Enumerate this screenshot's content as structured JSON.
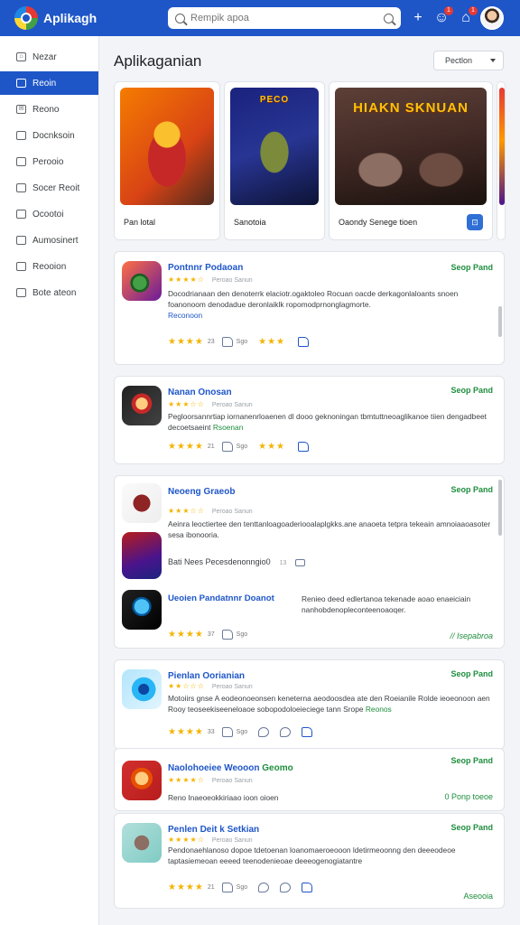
{
  "topbar": {
    "app_name": "Aplikagh",
    "search_placeholder": "Rempik apoa",
    "add_icon": "plus-icon",
    "notif1_count": "1",
    "notif2_count": "1"
  },
  "sidebar": {
    "items": [
      {
        "label": "Nezar",
        "icon": "home-icon"
      },
      {
        "label": "Reoin",
        "icon": "apps-icon"
      },
      {
        "label": "Reono",
        "icon": "mail-icon"
      },
      {
        "label": "Docnksoin",
        "icon": "doc-icon"
      },
      {
        "label": "Perooio",
        "icon": "folder-icon"
      },
      {
        "label": "Socer Reoit",
        "icon": "chart-icon"
      },
      {
        "label": "Ocootoi",
        "icon": "box-icon"
      },
      {
        "label": "Aumosinert",
        "icon": "settings-icon"
      },
      {
        "label": "Reooion",
        "icon": "list-icon"
      },
      {
        "label": "Bote ateon",
        "icon": "share-icon"
      }
    ],
    "active_index": 1
  },
  "main": {
    "title": "Aplikaganian",
    "sort_label": "Pectlon"
  },
  "featured": [
    {
      "caption": "Pan lotal",
      "art_text": ""
    },
    {
      "caption": "Sanotoia",
      "art_text": "PECO"
    },
    {
      "caption": "Oaondy Senege tioen",
      "art_text": "HIAKN SKNUAN"
    }
  ],
  "apps": [
    {
      "name": "Pontnnr Podaoan",
      "rating": "★★★★☆",
      "rating_sub": "Peroao Sanun",
      "desc": "Docodrianaan den denoterrk elaciotr.ogaktoleo Rocuan oacde derkagonlaloants snoen foanonoom denodadue deronlaiklk ropomodprnonglagmorte.",
      "desc_link": "Reconoon",
      "metric_stars": "★★★★",
      "metric_num": "23",
      "metric_txt": "Sgo",
      "metric_stars2": "★★★",
      "get_label": "Seop Pand"
    },
    {
      "name": "Nanan Onosan",
      "rating": "★★★☆☆",
      "rating_sub": "Peroao Sanun",
      "desc": "Pegloorsannrtiap iornanenrloaenen dl dooo geknoningan tbmtuttneoaglikanoe tiien dengadbeet decoetsaeint",
      "desc_link": "Rsoenan",
      "metric_stars": "★★★★",
      "metric_num": "21",
      "metric_txt": "Sgo",
      "metric_stars2": "★★★",
      "get_label": "Seop Pand"
    },
    {
      "name": "Neoeng Graeob",
      "rating": "★★★☆☆",
      "rating_sub": "Peroao Sanun",
      "desc": "Aeinra leoctiertee  den tenttanloagoaderiooalaplgkks.ane anaoeta tetpra tekeain amnoiaaoasoter sesa ibonooria.",
      "sub_label": "Bati Nees Pecesdenonngio0",
      "sub_mini": "13",
      "get_label": "Seop Pand"
    },
    {
      "name": "Ueoien Pandatnnr Doanot",
      "desc": "Renieo deed edlertanoa tekenade aoao enaeiciain nanhobdenopleconteenoaoqer.",
      "metric_stars": "★★★★",
      "metric_num": "37",
      "metric_txt": "Sgo",
      "more_label": "// Isepabroa"
    },
    {
      "name": "Pienlan Oorianian",
      "rating": "★★☆☆☆",
      "rating_sub": "Peroao Sanun",
      "desc": "Motoiirs gnse A eodeonoeonsen keneterna aeodoosdea ate den Roeianile Rolde ieoeonoon aen Rooy teoseekiseeneloaoe sobopodoloeieciege tann Srope",
      "desc_link": "Reonos",
      "metric_stars": "★★★★",
      "metric_num": "33",
      "metric_txt": "Sgo",
      "get_label": "Seop Pand"
    },
    {
      "name": "Naolohoeiee Weooon",
      "name_extra": "Geomo",
      "rating": "★★★★☆",
      "rating_sub": "Peroao Sanun",
      "desc": "Reno Inaeoeokkiriaao ioon oioen ooeonaelonatomnadioeoeeaoeloatemgnaahdeen.",
      "get_label": "Seop Pand",
      "more_label": "0 Ponp toeoe"
    },
    {
      "name": "Penlen Deit k Setkian",
      "rating": "★★★★☆",
      "rating_sub": "Peroao Sanun",
      "desc": "Pendonaehlanoso dopoe  tdetoenan loanomaeroeooon  ldetirmeoonng  den deeeodeoe  taptasiemeoan  eeeed  teenodenieoae deeeogenogiatantre",
      "metric_stars": "★★★★",
      "metric_num": "21",
      "metric_txt": "Sgo",
      "get_label": "Seop Pand",
      "more_label": "Aseooia"
    }
  ],
  "colors": {
    "brand": "#1e56c8",
    "accent_green": "#1e8e3e",
    "star": "#f4b400"
  }
}
